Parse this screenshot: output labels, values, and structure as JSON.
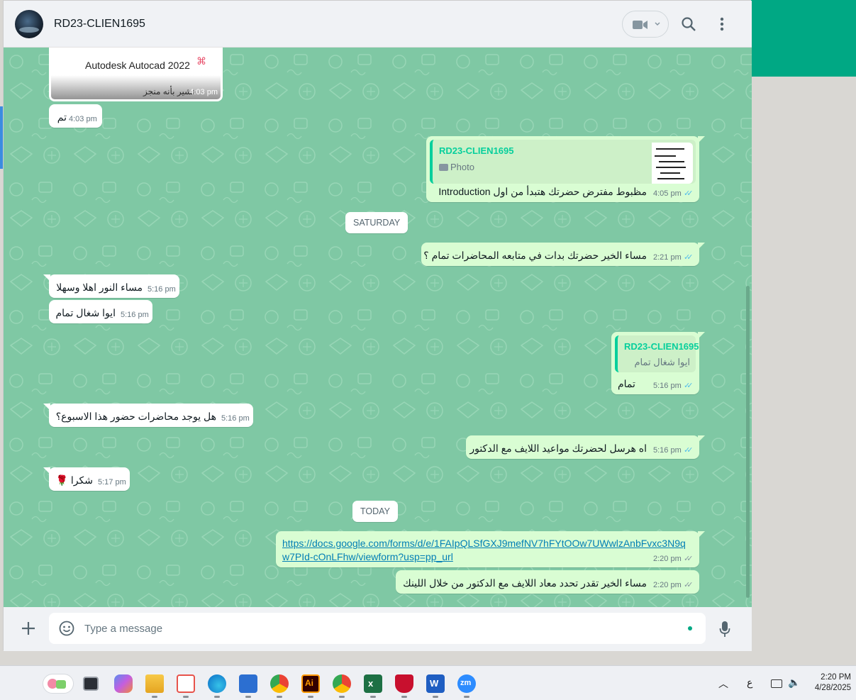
{
  "header": {
    "contact_name": "RD23-CLIEN1695"
  },
  "messages": {
    "doc": {
      "title": "Autodesk Autocad 2022",
      "caption": "تشير بأنه منجز",
      "time": "4:03 pm"
    },
    "m1": {
      "text": "تم",
      "time": "4:03 pm"
    },
    "m2": {
      "quote_name": "RD23-CLIEN1695",
      "quote_type": "Photo",
      "text": "مظبوط مفترض حضرتك هتبدأ من اول  Introduction",
      "time": "4:05 pm"
    },
    "date1": "SATURDAY",
    "m3": {
      "text": "مساء الخير حضرتك بدات في متابعه المحاضرات تمام ؟",
      "time": "2:21 pm"
    },
    "m4": {
      "text": "مساء النور اهلا وسهلا",
      "time": "5:16 pm"
    },
    "m5": {
      "text": "ايوا شغال تمام",
      "time": "5:16 pm"
    },
    "m6": {
      "quote_name": "RD23-CLIEN1695",
      "quote_text": "ايوا شغال تمام",
      "text": "تمام",
      "time": "5:16 pm"
    },
    "m7": {
      "text": "هل يوجد محاضرات حضور هذا الاسبوع؟",
      "time": "5:16 pm"
    },
    "m8": {
      "text": "اه هرسل لحضرتك مواعيد اللايف مع الدكتور",
      "time": "5:16 pm"
    },
    "m9": {
      "text": "شكرا 🌹",
      "time": "5:17 pm"
    },
    "date2": "TODAY",
    "m10": {
      "link": "https://docs.google.com/forms/d/e/1FAIpQLSfGXJ9mefNV7hFYtOOw7UWwlzAnbFvxc3N9qw7PId-cOnLFhw/viewform?usp=pp_url",
      "time": "2:20 pm"
    },
    "m11": {
      "text": "مساء الخير تقدر تحدد معاد اللايف مع الدكتور من خلال اللينك",
      "time": "2:20 pm"
    }
  },
  "composer": {
    "placeholder": "Type a message"
  },
  "taskbar": {
    "tray_lang": "ع",
    "time": "2:20 PM",
    "date": "4/28/2025"
  },
  "colors": {
    "accent": "#00a884",
    "chat_bg": "#7fc8a4",
    "outgoing_bubble": "#d9fdd3",
    "incoming_bubble": "#ffffff",
    "read_ticks": "#53bdeb"
  },
  "icons": [
    "video-call-icon",
    "search-icon",
    "menu-icon",
    "attach-plus-icon",
    "emoji-icon",
    "mic-icon"
  ]
}
